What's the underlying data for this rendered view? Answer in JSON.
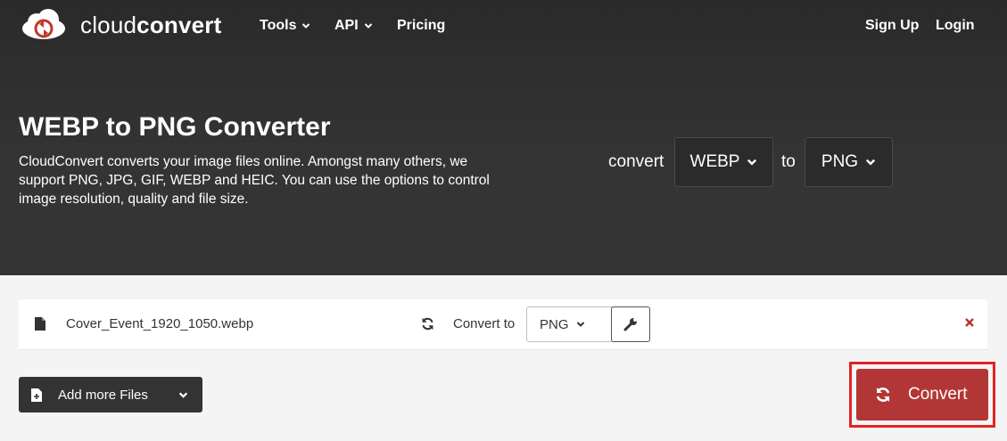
{
  "nav": {
    "brand_light": "cloud",
    "brand_bold": "convert",
    "tools_label": "Tools",
    "api_label": "API",
    "pricing_label": "Pricing",
    "signup_label": "Sign Up",
    "login_label": "Login"
  },
  "hero": {
    "title": "WEBP to PNG Converter",
    "description": "CloudConvert converts your image files online. Amongst many others, we support PNG, JPG, GIF, WEBP and HEIC. You can use the options to control image resolution, quality and file size.",
    "convert_label": "convert",
    "from_format": "WEBP",
    "to_label": "to",
    "to_format": "PNG"
  },
  "file": {
    "name": "Cover_Event_1920_1050.webp",
    "convert_to_label": "Convert to",
    "target_format": "PNG"
  },
  "actions": {
    "add_files_label": "Add more Files",
    "convert_label": "Convert"
  },
  "colors": {
    "hero_bg": "#333333",
    "convert_button": "#b33636",
    "highlight_outline": "#e02424",
    "remove_icon": "#b33636"
  },
  "icons": [
    "cloudconvert-logo-icon",
    "chevron-down-icon",
    "file-icon",
    "sync-icon",
    "wrench-icon",
    "close-icon",
    "add-file-icon"
  ]
}
